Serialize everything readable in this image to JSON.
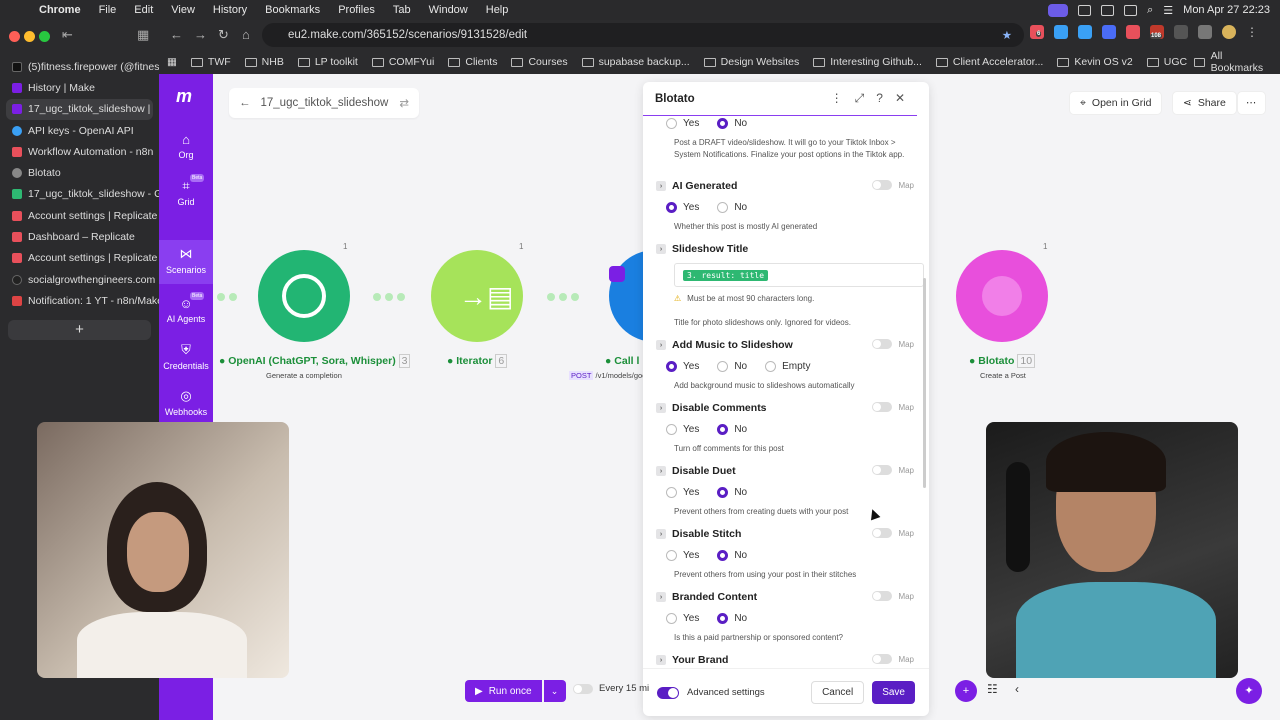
{
  "menubar": {
    "app": "Chrome",
    "items": [
      "File",
      "Edit",
      "View",
      "History",
      "Bookmarks",
      "Profiles",
      "Tab",
      "Window",
      "Help"
    ],
    "clock": "Mon Apr 27  22:23",
    "badge_108": "108",
    "badge_6": "6"
  },
  "browser": {
    "url": "eu2.make.com/365152/scenarios/9131528/edit",
    "bookmarks": [
      "TWF",
      "NHB",
      "LP toolkit",
      "COMFYui",
      "Clients",
      "Courses",
      "supabase backup...",
      "Design Websites",
      "Interesting Github...",
      "Client Accelerator...",
      "Kevin OS v2",
      "UGC"
    ],
    "all_bookmarks": "All Bookmarks",
    "tabs": [
      {
        "label": "(5)fitness.firepower (@fitness.",
        "color": "#111"
      },
      {
        "label": "History | Make",
        "color": "#7b1fe4"
      },
      {
        "label": "17_ugc_tiktok_slideshow |",
        "color": "#7b1fe4"
      },
      {
        "label": "API keys - OpenAI API",
        "color": "#3aa0f5"
      },
      {
        "label": "Workflow Automation - n8n",
        "color": "#e8505b"
      },
      {
        "label": "Blotato",
        "color": "#888"
      },
      {
        "label": "17_ugc_tiktok_slideshow - Go",
        "color": "#2eb872"
      },
      {
        "label": "Account settings | Replicate",
        "color": "#e8505b"
      },
      {
        "label": "Dashboard – Replicate",
        "color": "#e8505b"
      },
      {
        "label": "Account settings | Replicate",
        "color": "#e8505b"
      },
      {
        "label": "socialgrowthengineers.com",
        "color": "#222"
      },
      {
        "label": "Notification: 1 YT - n8n/Make",
        "color": "#d44"
      }
    ]
  },
  "rail": {
    "items": [
      {
        "label": "Org",
        "icon": "home-icon"
      },
      {
        "label": "Grid",
        "icon": "grid-icon",
        "beta": "Beta"
      },
      {
        "label": "Scenarios",
        "icon": "share-icon"
      },
      {
        "label": "AI Agents",
        "icon": "robot-icon",
        "beta": "Beta"
      },
      {
        "label": "Credentials",
        "icon": "shield-icon"
      },
      {
        "label": "Webhooks",
        "icon": "globe-icon"
      }
    ]
  },
  "scenario": {
    "name": "17_ugc_tiktok_slideshow",
    "open_in_grid": "Open in Grid",
    "share": "Share",
    "nodes": [
      {
        "label": "OpenAI (ChatGPT, Sora, Whisper)",
        "num": "3",
        "sub": "Generate a completion",
        "ops": "1"
      },
      {
        "label": "Iterator",
        "num": "6",
        "sub": "",
        "ops": "1"
      },
      {
        "label": "Call l",
        "num": "",
        "sub": "/v1/models/goo",
        "method": "POST",
        "ops": ""
      },
      {
        "label": "Blotato",
        "num": "10",
        "sub": "Create a Post",
        "ops": "1"
      }
    ],
    "run_once": "Run once",
    "schedule": "Every 15 mi"
  },
  "panel": {
    "title": "Blotato",
    "map_label": "Map",
    "sections": [
      {
        "title": "",
        "options": [
          "Yes",
          "No"
        ],
        "selected": "No",
        "help": "Post a DRAFT video/slideshow. It will go to your Tiktok Inbox > System Notifications. Finalize your post options in the Tiktok app."
      },
      {
        "title": "AI Generated",
        "options": [
          "Yes",
          "No"
        ],
        "selected": "Yes",
        "help": "Whether this post is mostly AI generated"
      },
      {
        "title": "Slideshow Title",
        "chip": "3. result: title",
        "warn": "Must be at most 90 characters long.",
        "help": "Title for photo slideshows only. Ignored for videos."
      },
      {
        "title": "Add Music to Slideshow",
        "options": [
          "Yes",
          "No",
          "Empty"
        ],
        "selected": "Yes",
        "help": "Add background music to slideshows automatically"
      },
      {
        "title": "Disable Comments",
        "options": [
          "Yes",
          "No"
        ],
        "selected": "No",
        "help": "Turn off comments for this post"
      },
      {
        "title": "Disable Duet",
        "options": [
          "Yes",
          "No"
        ],
        "selected": "No",
        "help": "Prevent others from creating duets with your post"
      },
      {
        "title": "Disable Stitch",
        "options": [
          "Yes",
          "No"
        ],
        "selected": "No",
        "help": "Prevent others from using your post in their stitches"
      },
      {
        "title": "Branded Content",
        "options": [
          "Yes",
          "No"
        ],
        "selected": "No",
        "help": "Is this a paid partnership or sponsored content?"
      },
      {
        "title": "Your Brand"
      }
    ],
    "advanced": "Advanced settings",
    "cancel": "Cancel",
    "save": "Save"
  }
}
